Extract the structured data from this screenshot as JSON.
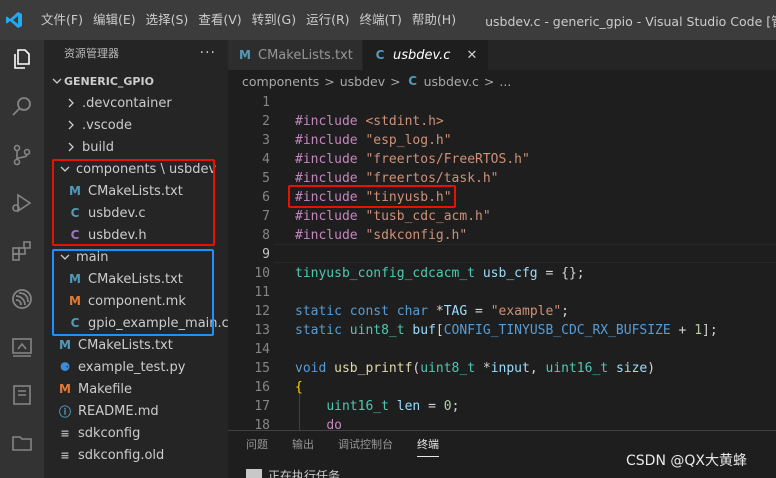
{
  "menu": [
    "文件(F)",
    "编辑(E)",
    "选择(S)",
    "查看(V)",
    "转到(G)",
    "运行(R)",
    "终端(T)",
    "帮助(H)"
  ],
  "window_title": "usbdev.c - generic_gpio - Visual Studio Code [管...",
  "sidebar": {
    "title": "资源管理器",
    "more": "···",
    "project": "GENERIC_GPIO",
    "items": [
      {
        "label": ".devcontainer",
        "icon": "chevron-right",
        "glyph": "›"
      },
      {
        "label": ".vscode",
        "icon": "chevron-right",
        "glyph": "›"
      },
      {
        "label": "build",
        "icon": "chevron-right",
        "glyph": "›"
      },
      {
        "label": "components \\ usbdev",
        "icon": "chevron-down",
        "glyph": "⌄"
      },
      {
        "label": "CMakeLists.txt",
        "icon": "cmake",
        "glyph": "M"
      },
      {
        "label": "usbdev.c",
        "icon": "c-file",
        "glyph": "C"
      },
      {
        "label": "usbdev.h",
        "icon": "h-file",
        "glyph": "C"
      },
      {
        "label": "main",
        "icon": "chevron-down",
        "glyph": "⌄"
      },
      {
        "label": "CMakeLists.txt",
        "icon": "cmake",
        "glyph": "M"
      },
      {
        "label": "component.mk",
        "icon": "makefile",
        "glyph": "M"
      },
      {
        "label": "gpio_example_main.c",
        "icon": "c-file",
        "glyph": "C"
      },
      {
        "label": "CMakeLists.txt",
        "icon": "cmake",
        "glyph": "M"
      },
      {
        "label": "example_test.py",
        "icon": "python",
        "glyph": "⚈"
      },
      {
        "label": "Makefile",
        "icon": "makefile",
        "glyph": "M"
      },
      {
        "label": "README.md",
        "icon": "info",
        "glyph": "ⓘ"
      },
      {
        "label": "sdkconfig",
        "icon": "config",
        "glyph": "≡"
      },
      {
        "label": "sdkconfig.old",
        "icon": "config",
        "glyph": "≡"
      }
    ]
  },
  "tabs": [
    {
      "label": "CMakeLists.txt",
      "icon": "M",
      "active": false
    },
    {
      "label": "usbdev.c",
      "icon": "C",
      "active": true,
      "close": "✕"
    }
  ],
  "breadcrumb": {
    "parts": [
      "components",
      "usbdev",
      "usbdev.c",
      "..."
    ],
    "sep": ">",
    "file_icon": "C"
  },
  "code_lines": [
    {
      "n": "1",
      "t": []
    },
    {
      "n": "2",
      "t": [
        [
          "kw-dir",
          "#include"
        ],
        [
          "plain",
          " "
        ],
        [
          "str",
          "<stdint.h>"
        ]
      ]
    },
    {
      "n": "3",
      "t": [
        [
          "kw-dir",
          "#include"
        ],
        [
          "plain",
          " "
        ],
        [
          "str",
          "\"esp_log.h\""
        ]
      ]
    },
    {
      "n": "4",
      "t": [
        [
          "kw-dir",
          "#include"
        ],
        [
          "plain",
          " "
        ],
        [
          "str",
          "\"freertos/FreeRTOS.h\""
        ]
      ]
    },
    {
      "n": "5",
      "t": [
        [
          "kw-dir",
          "#include"
        ],
        [
          "plain",
          " "
        ],
        [
          "str",
          "\"freertos/task.h\""
        ]
      ]
    },
    {
      "n": "6",
      "t": [
        [
          "kw-dir",
          "#include"
        ],
        [
          "plain",
          " "
        ],
        [
          "str",
          "\"tinyusb.h\""
        ]
      ]
    },
    {
      "n": "7",
      "t": [
        [
          "kw-dir",
          "#include"
        ],
        [
          "plain",
          " "
        ],
        [
          "str",
          "\"tusb_cdc_acm.h\""
        ]
      ]
    },
    {
      "n": "8",
      "t": [
        [
          "kw-dir",
          "#include"
        ],
        [
          "plain",
          " "
        ],
        [
          "str",
          "\"sdkconfig.h\""
        ]
      ]
    },
    {
      "n": "9",
      "t": []
    },
    {
      "n": "10",
      "t": [
        [
          "typ",
          "tinyusb_config_cdcacm_t"
        ],
        [
          "plain",
          " "
        ],
        [
          "var",
          "usb_cfg"
        ],
        [
          "plain",
          " = {};"
        ]
      ]
    },
    {
      "n": "11",
      "t": []
    },
    {
      "n": "12",
      "t": [
        [
          "kw",
          "static"
        ],
        [
          "plain",
          " "
        ],
        [
          "kw",
          "const"
        ],
        [
          "plain",
          " "
        ],
        [
          "kw",
          "char"
        ],
        [
          "plain",
          " *"
        ],
        [
          "var",
          "TAG"
        ],
        [
          "plain",
          " = "
        ],
        [
          "str",
          "\"example\""
        ],
        [
          "plain",
          ";"
        ]
      ]
    },
    {
      "n": "13",
      "t": [
        [
          "kw",
          "static"
        ],
        [
          "plain",
          " "
        ],
        [
          "typ",
          "uint8_t"
        ],
        [
          "plain",
          " "
        ],
        [
          "var",
          "buf"
        ],
        [
          "plain",
          "["
        ],
        [
          "mac",
          "CONFIG_TINYUSB_CDC_RX_BUFSIZE"
        ],
        [
          "plain",
          " + "
        ],
        [
          "num",
          "1"
        ],
        [
          "plain",
          "];"
        ]
      ]
    },
    {
      "n": "14",
      "t": []
    },
    {
      "n": "15",
      "t": [
        [
          "kw",
          "void"
        ],
        [
          "plain",
          " "
        ],
        [
          "fn",
          "usb_printf"
        ],
        [
          "plain",
          "("
        ],
        [
          "typ",
          "uint8_t"
        ],
        [
          "plain",
          " *"
        ],
        [
          "var",
          "input"
        ],
        [
          "plain",
          ", "
        ],
        [
          "typ",
          "uint16_t"
        ],
        [
          "plain",
          " "
        ],
        [
          "var",
          "size"
        ],
        [
          "plain",
          ")"
        ]
      ]
    },
    {
      "n": "16",
      "t": [
        [
          "brace",
          "{"
        ]
      ]
    },
    {
      "n": "17",
      "t": [
        [
          "plain",
          "    "
        ],
        [
          "typ",
          "uint16_t"
        ],
        [
          "plain",
          " "
        ],
        [
          "var",
          "len"
        ],
        [
          "plain",
          " = "
        ],
        [
          "num",
          "0"
        ],
        [
          "plain",
          ";"
        ]
      ]
    },
    {
      "n": "18",
      "t": [
        [
          "plain",
          "    "
        ],
        [
          "kw-dir",
          "do"
        ]
      ]
    }
  ],
  "panel": {
    "tabs": [
      "问题",
      "输出",
      "调试控制台",
      "终端"
    ],
    "active": 3,
    "line_text": "正在执行任务"
  },
  "watermark": "CSDN @QX大黄蜂",
  "colors": {
    "highlight_red": "#e51400",
    "highlight_blue": "#1e90ff",
    "accent": "#007acc"
  }
}
